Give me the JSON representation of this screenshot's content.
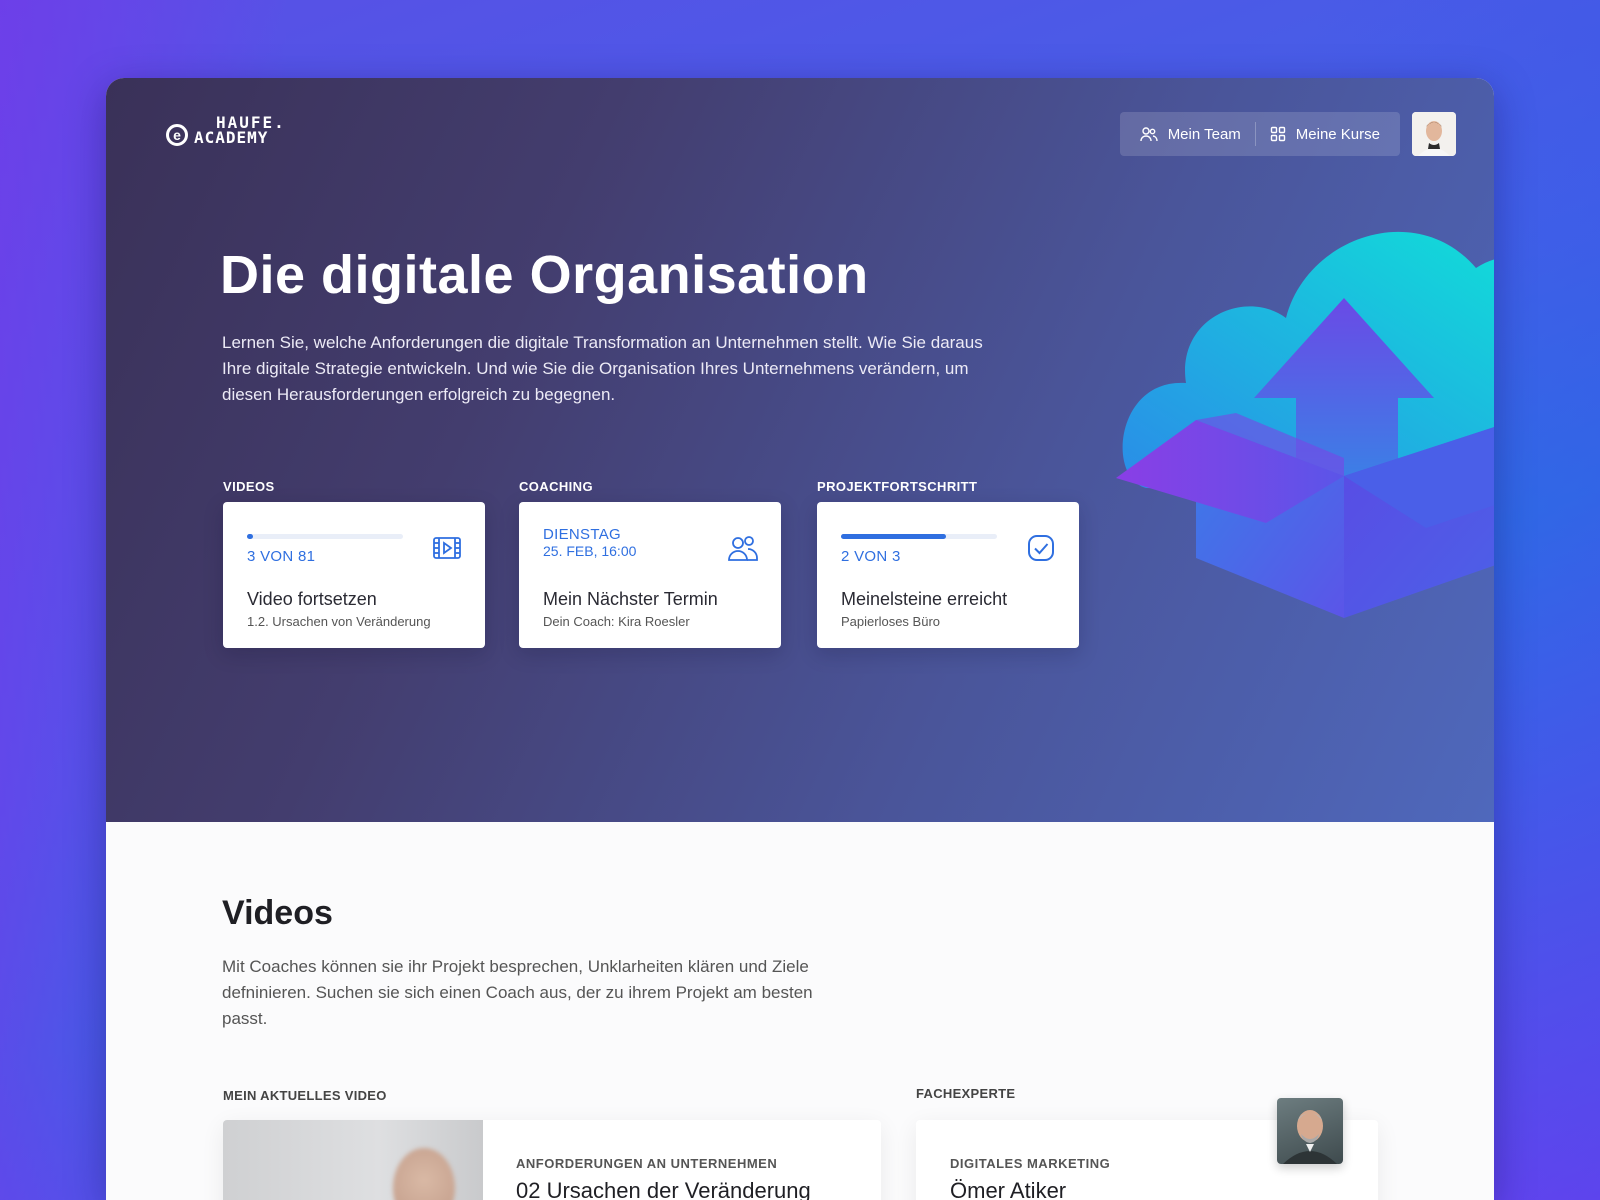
{
  "brand": {
    "logo_top": "HAUFE.",
    "logo_bottom": "ACADEMY",
    "logo_mark": "e"
  },
  "nav": {
    "items": [
      {
        "label": "Mein Team",
        "icon": "team-icon"
      },
      {
        "label": "Meine Kurse",
        "icon": "grid-icon"
      }
    ]
  },
  "hero": {
    "title": "Die digitale Organisation",
    "description": "Lernen Sie, welche Anforderungen die digitale Transformation an Unternehmen stellt. Wie Sie daraus Ihre digitale Strategie entwickeln. Und wie Sie die Organisation Ihres Unternehmens verändern, um diesen Herausforderungen erfolgreich zu begegnen."
  },
  "stats": {
    "videos": {
      "label": "VIDEOS",
      "count": "3 VON 81",
      "progress": 0.04,
      "title": "Video fortsetzen",
      "sub": "1.2. Ursachen von Veränderung"
    },
    "coaching": {
      "label": "COACHING",
      "day": "DIENSTAG",
      "date": "25. FEB, 16:00",
      "title": "Mein Nächster Termin",
      "sub": "Dein Coach: Kira Roesler"
    },
    "project": {
      "label": "PROJEKTFORTSCHRITT",
      "count": "2 VON 3",
      "progress": 0.67,
      "title": "Meinelsteine erreicht",
      "sub": "Papierloses Büro"
    }
  },
  "content": {
    "title": "Videos",
    "description": "Mit Coaches können sie ihr Projekt besprechen, Unklarheiten klären und Ziele defninieren. Suchen sie sich einen Coach aus, der zu ihrem Projekt am besten passt.",
    "current_video": {
      "label": "MEIN AKTUELLES VIDEO",
      "category": "ANFORDERUNGEN AN UNTERNEHMEN",
      "title": "02 Ursachen der Veränderung"
    },
    "expert": {
      "label": "FACHEXPERTE",
      "category": "DIGITALES MARKETING",
      "name": "Ömer Atiker"
    }
  },
  "colors": {
    "accent": "#2f6fe0"
  }
}
